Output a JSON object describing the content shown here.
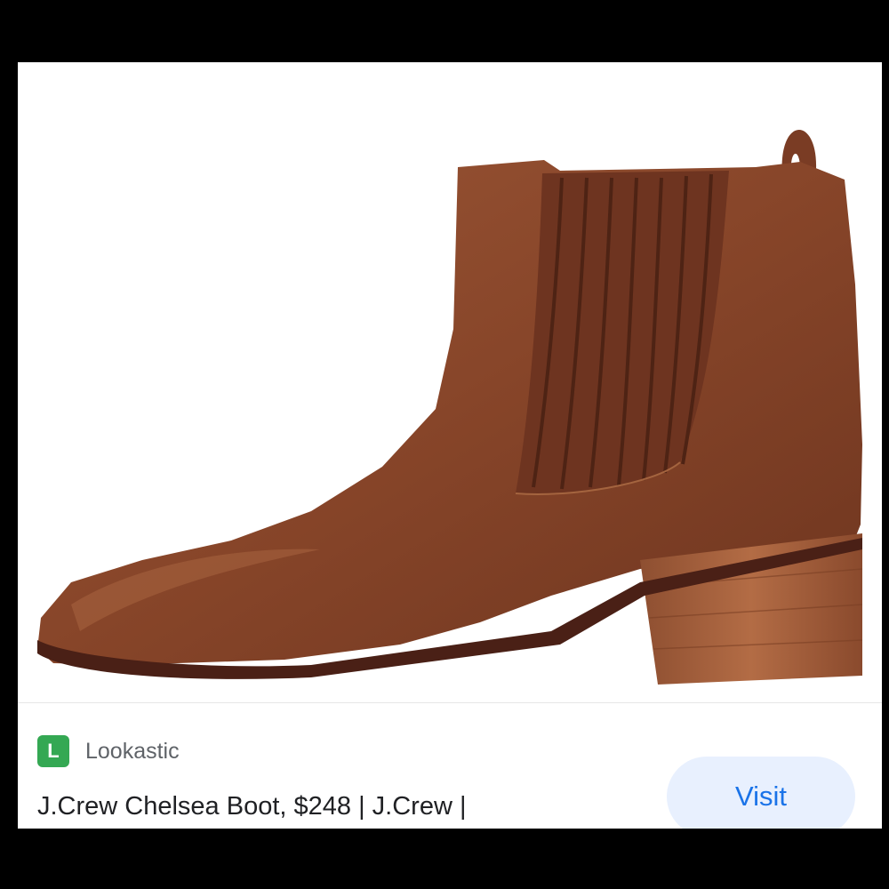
{
  "image": {
    "subject": "boot-photo",
    "colors": {
      "leather": "#8a4a30",
      "leather_dark": "#5e2e1c",
      "heel": "#a5603d",
      "sole": "#4a2016"
    }
  },
  "source": {
    "favicon_letter": "L",
    "name": "Lookastic",
    "favicon_color": "#34a853"
  },
  "product": {
    "title": "J.Crew Chelsea Boot, $248 | J.Crew |"
  },
  "actions": {
    "visit_label": "Visit"
  }
}
